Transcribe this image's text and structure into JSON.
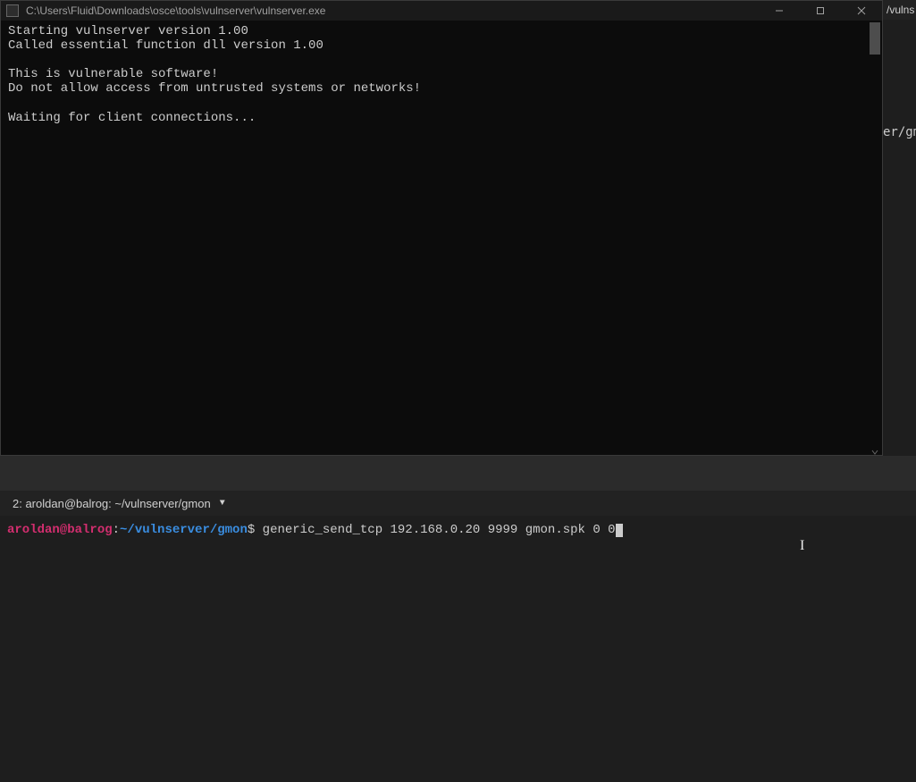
{
  "window": {
    "title": "C:\\Users\\Fluid\\Downloads\\osce\\tools\\vulnserver\\vulnserver.exe",
    "console_lines": [
      "Starting vulnserver version 1.00",
      "Called essential function dll version 1.00",
      "",
      "This is vulnerable software!",
      "Do not allow access from untrusted systems or networks!",
      "",
      "Waiting for client connections..."
    ]
  },
  "background": {
    "tab_fragment": "/vulns",
    "text_fragment": "er/gm"
  },
  "bottom_terminal": {
    "tab": "2: aroldan@balrog: ~/vulnserver/gmon",
    "prompt_user": "aroldan@balrog",
    "prompt_colon": ":",
    "prompt_path": "~/vulnserver/gmon",
    "prompt_dollar": "$",
    "command": " generic_send_tcp 192.168.0.20 9999 gmon.spk 0 0"
  }
}
